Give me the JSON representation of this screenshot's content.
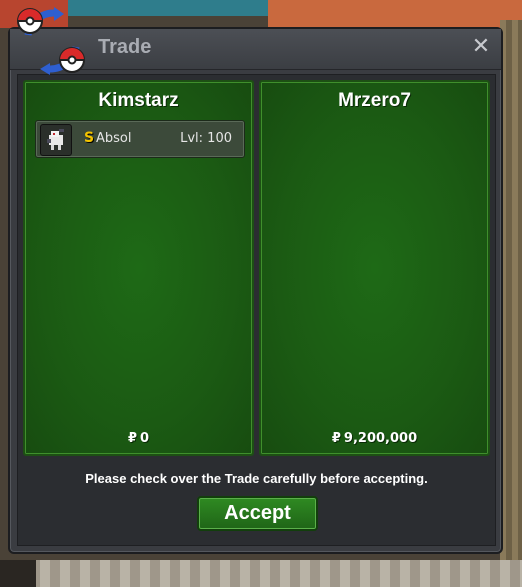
{
  "window": {
    "title": "Trade",
    "close_glyph": "✕",
    "logo_icon": "trade-swap-icon"
  },
  "left_panel": {
    "player_name": "Kimstarz",
    "currency_symbol": "₽",
    "money": "0",
    "items": [
      {
        "sprite_icon": "absol-sprite-icon",
        "shiny_marker": "S",
        "pokemon_name": "Absol",
        "level_text": "Lvl: 100"
      }
    ]
  },
  "right_panel": {
    "player_name": "Mrzero7",
    "currency_symbol": "₽",
    "money": "9,200,000"
  },
  "footer": {
    "notice": "Please check over the Trade carefully before accepting.",
    "accept_label": "Accept"
  },
  "colors": {
    "panel_green": "#1e6a16",
    "accept_green": "#2f8a22",
    "window_bg": "#3a3c41",
    "shiny_gold": "#f3c300"
  }
}
